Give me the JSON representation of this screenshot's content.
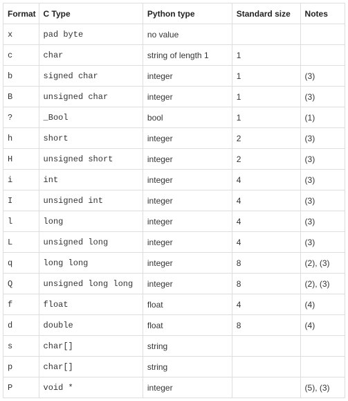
{
  "headers": {
    "format": "Format",
    "ctype": "C Type",
    "python": "Python type",
    "size": "Standard size",
    "notes": "Notes"
  },
  "rows": [
    {
      "format": "x",
      "ctype": "pad byte",
      "python": "no value",
      "size": "",
      "notes": ""
    },
    {
      "format": "c",
      "ctype": "char",
      "python": "string of length 1",
      "size": "1",
      "notes": ""
    },
    {
      "format": "b",
      "ctype": "signed char",
      "python": "integer",
      "size": "1",
      "notes": "(3)"
    },
    {
      "format": "B",
      "ctype": "unsigned char",
      "python": "integer",
      "size": "1",
      "notes": "(3)"
    },
    {
      "format": "?",
      "ctype": "_Bool",
      "python": "bool",
      "size": "1",
      "notes": "(1)"
    },
    {
      "format": "h",
      "ctype": "short",
      "python": "integer",
      "size": "2",
      "notes": "(3)"
    },
    {
      "format": "H",
      "ctype": "unsigned short",
      "python": "integer",
      "size": "2",
      "notes": "(3)"
    },
    {
      "format": "i",
      "ctype": "int",
      "python": "integer",
      "size": "4",
      "notes": "(3)"
    },
    {
      "format": "I",
      "ctype": "unsigned int",
      "python": "integer",
      "size": "4",
      "notes": "(3)"
    },
    {
      "format": "l",
      "ctype": "long",
      "python": "integer",
      "size": "4",
      "notes": "(3)"
    },
    {
      "format": "L",
      "ctype": "unsigned long",
      "python": "integer",
      "size": "4",
      "notes": "(3)"
    },
    {
      "format": "q",
      "ctype": "long long",
      "python": "integer",
      "size": "8",
      "notes": "(2), (3)"
    },
    {
      "format": "Q",
      "ctype": "unsigned long long",
      "python": "integer",
      "size": "8",
      "notes": "(2), (3)"
    },
    {
      "format": "f",
      "ctype": "float",
      "python": "float",
      "size": "4",
      "notes": "(4)"
    },
    {
      "format": "d",
      "ctype": "double",
      "python": "float",
      "size": "8",
      "notes": "(4)"
    },
    {
      "format": "s",
      "ctype": "char[]",
      "python": "string",
      "size": "",
      "notes": ""
    },
    {
      "format": "p",
      "ctype": "char[]",
      "python": "string",
      "size": "",
      "notes": ""
    },
    {
      "format": "P",
      "ctype": "void *",
      "python": "integer",
      "size": "",
      "notes": "(5), (3)"
    }
  ]
}
